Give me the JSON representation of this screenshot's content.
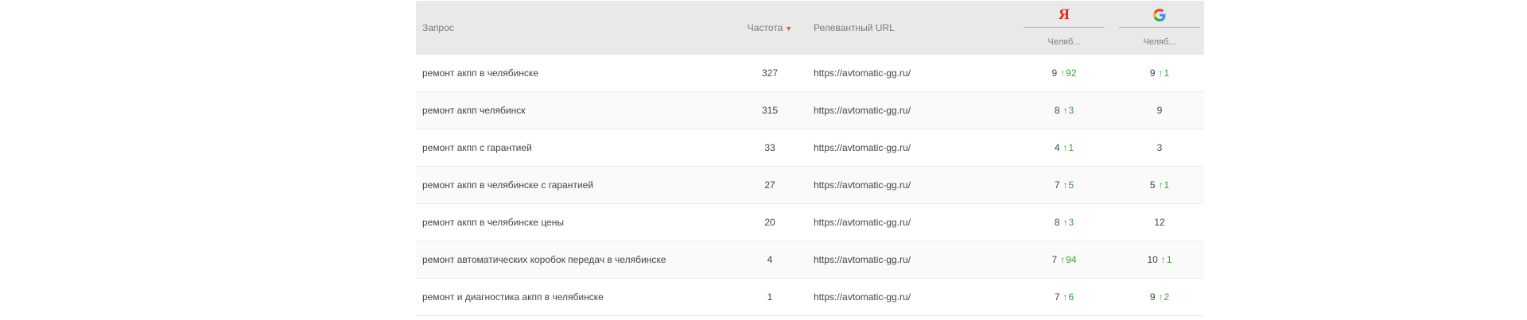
{
  "header": {
    "query": "Запрос",
    "frequency": "Частота",
    "url": "Релевантный URL",
    "yandex_logo": "Я",
    "yandex_region": "Челяб...",
    "google_region": "Челяб..."
  },
  "colors": {
    "yandex": "#e42717",
    "delta_up": "#3da13d",
    "sort_arrow": "#e8542a"
  },
  "rows": [
    {
      "query": "ремонт акпп в челябинске",
      "freq": "327",
      "url": "https://avtomatic-gg.ru/",
      "y_pos": "9",
      "y_delta": "92",
      "g_pos": "9",
      "g_delta": "1"
    },
    {
      "query": "ремонт акпп челябинск",
      "freq": "315",
      "url": "https://avtomatic-gg.ru/",
      "y_pos": "8",
      "y_delta": "3",
      "g_pos": "9",
      "g_delta": ""
    },
    {
      "query": "ремонт акпп с гарантией",
      "freq": "33",
      "url": "https://avtomatic-gg.ru/",
      "y_pos": "4",
      "y_delta": "1",
      "g_pos": "3",
      "g_delta": ""
    },
    {
      "query": "ремонт акпп в челябинске с гарантией",
      "freq": "27",
      "url": "https://avtomatic-gg.ru/",
      "y_pos": "7",
      "y_delta": "5",
      "g_pos": "5",
      "g_delta": "1"
    },
    {
      "query": "ремонт акпп в челябинске цены",
      "freq": "20",
      "url": "https://avtomatic-gg.ru/",
      "y_pos": "8",
      "y_delta": "3",
      "g_pos": "12",
      "g_delta": ""
    },
    {
      "query": "ремонт автоматических коробок передач в челябинске",
      "freq": "4",
      "url": "https://avtomatic-gg.ru/",
      "y_pos": "7",
      "y_delta": "94",
      "g_pos": "10",
      "g_delta": "1"
    },
    {
      "query": "ремонт и диагностика акпп в челябинске",
      "freq": "1",
      "url": "https://avtomatic-gg.ru/",
      "y_pos": "7",
      "y_delta": "6",
      "g_pos": "9",
      "g_delta": "2"
    }
  ]
}
